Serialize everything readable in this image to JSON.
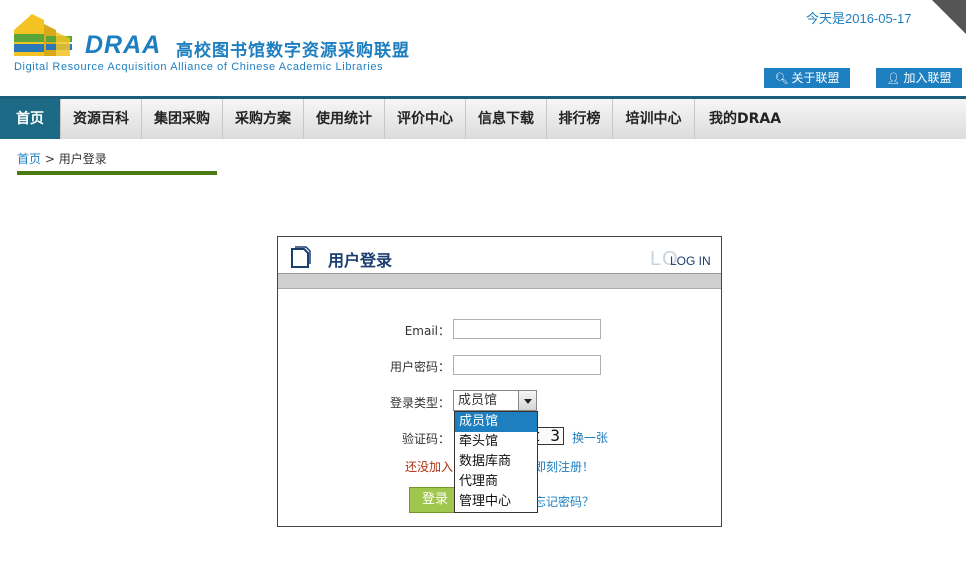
{
  "header": {
    "brand_name": "DRAA",
    "brand_cn": "高校图书馆数字资源采购联盟",
    "brand_en": "Digital Resource Acquisition Alliance of Chinese Academic Libraries",
    "date_text": "今天是2016-05-17",
    "about_button": "关于联盟",
    "join_button": "加入联盟",
    "colors": {
      "brand_blue": "#1e7fc0",
      "logo_yellow": "#f2c322",
      "logo_green": "#5aa53a",
      "logo_blue": "#2a78b8"
    }
  },
  "nav": {
    "items": [
      {
        "label": "首页",
        "active": true
      },
      {
        "label": "资源百科"
      },
      {
        "label": "集团采购"
      },
      {
        "label": "采购方案"
      },
      {
        "label": "使用统计"
      },
      {
        "label": "评价中心"
      },
      {
        "label": "信息下载"
      },
      {
        "label": "排行榜"
      },
      {
        "label": "培训中心"
      },
      {
        "label": "我的DRAA"
      }
    ],
    "active_color": "#1d6a86"
  },
  "breadcrumb": {
    "home": "首页",
    "separator": ">",
    "current": "用户登录"
  },
  "login": {
    "title": "用户登录",
    "watermark": "LO",
    "badge": "LOG IN",
    "email_label": "Email：",
    "email_value": "",
    "password_label": "用户密码：",
    "password_value": "",
    "type_label": "登录类型：",
    "type_selected": "成员馆",
    "type_options": [
      "成员馆",
      "牵头馆",
      "数据库商",
      "代理商",
      "管理中心"
    ],
    "captcha_label": "验证码：",
    "captcha_text": "t 3",
    "refresh_captcha": "换一张",
    "not_member_text": "还没加入",
    "register_link": "即刻注册！",
    "login_button": "登录",
    "forgot_link": "忘记密码？",
    "button_color": "#9fc74e"
  }
}
